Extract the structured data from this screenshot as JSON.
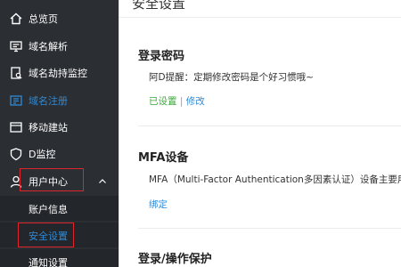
{
  "sidebar": {
    "items": [
      {
        "label": "总览页",
        "icon": "home-icon"
      },
      {
        "label": "域名解析",
        "icon": "monitor-icon"
      },
      {
        "label": "域名劫持监控",
        "icon": "document-search-icon"
      },
      {
        "label": "域名注册",
        "icon": "register-icon"
      },
      {
        "label": "移动建站",
        "icon": "mobile-site-icon"
      },
      {
        "label": "D监控",
        "icon": "shield-icon"
      },
      {
        "label": "用户中心",
        "icon": "user-icon"
      }
    ],
    "submenu": [
      {
        "label": "账户信息"
      },
      {
        "label": "安全设置"
      },
      {
        "label": "通知设置"
      }
    ]
  },
  "main": {
    "page_title": "安全设置",
    "sections": {
      "password": {
        "title": "登录密码",
        "tip": "阿D提醒：定期修改密码是个好习惯哦~",
        "status": "已设置",
        "separator": "|",
        "action": "修改"
      },
      "mfa": {
        "title": "MFA设备",
        "description": "MFA（Multi-Factor Authentication多因素认证）设备主要用于提",
        "action": "绑定"
      },
      "login_protection": {
        "title": "登录/操作保护"
      }
    }
  },
  "colors": {
    "sidebar_bg": "#2b2e33",
    "submenu_bg": "#23262a",
    "active_blue": "#2f8ad6",
    "highlight_red": "#e0242b",
    "status_green": "#3aa83a"
  }
}
